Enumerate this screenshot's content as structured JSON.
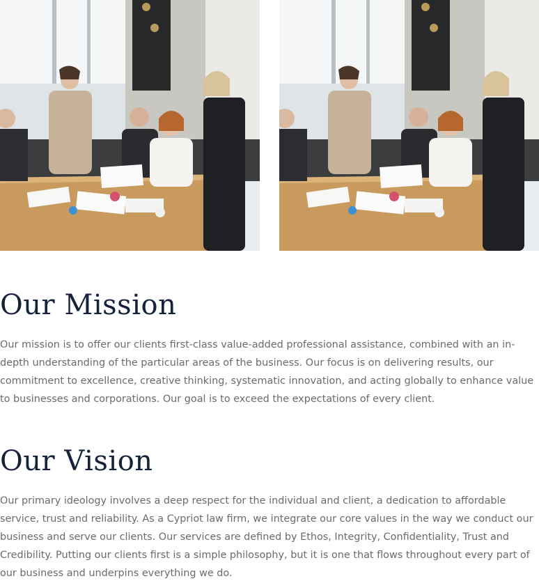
{
  "photos": [
    {
      "alt": "business-meeting-photo"
    },
    {
      "alt": "business-meeting-photo"
    }
  ],
  "mission": {
    "title": "Our Mission",
    "text": "Our mission is to offer our clients first-class value-added professional assistance, combined with an in-depth understanding of the particular areas of the business. Our focus is on delivering results, our commitment to excellence, creative thinking, systematic innovation, and acting globally to enhance value to businesses and corporations. Our goal is to exceed the expectations of every client."
  },
  "vision": {
    "title": "Our Vision",
    "text": "Our primary ideology involves a deep respect for the individual and client, a dedication to affordable service, trust and reliability. As a Cypriot law firm, we integrate our core values in the way we conduct our business and serve our clients. Our services are defined by Ethos, Integrity, Confidentiality, Trust and Credibility. Putting our clients first is a simple philosophy, but it is one that flows throughout every part of our business and underpins everything we do."
  },
  "colors": {
    "heading": "#16213a",
    "body_text": "#6b6b6b",
    "background": "#ffffff"
  }
}
